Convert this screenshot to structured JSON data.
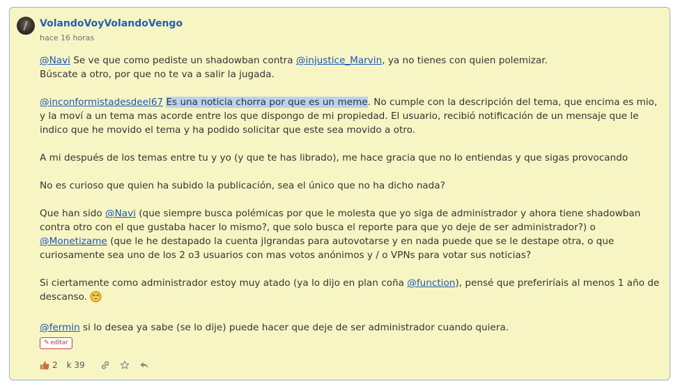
{
  "post": {
    "username": "VolandoVoyVolandoVengo",
    "timestamp": "hace 16 horas",
    "p1": {
      "m1": "@Navi",
      "t1": " Se ve que como pediste un shadowban contra ",
      "m2": "@injustice_Marvin",
      "t2": ", ya no tienes con quien polemizar.",
      "t3": "Búscate a otro, por que no te va a salir la jugada."
    },
    "p2": {
      "m1": "@inconformistadesdeel67",
      "highlight": "Es una noticia chorra por que es un meme",
      "t1": ". No cumple con la descripción del tema, que encima es mio, y la moví a un tema mas acorde entre los que dispongo de mi propiedad. El usuario, recibió notificación de un mensaje que le indico que he movido el tema y ha podido solicitar que este sea movido a otro."
    },
    "p3": "A mi después de los temas entre tu y yo (y que te has librado), me hace gracia que no lo entiendas y que sigas provocando",
    "p4": "No es curioso que quien ha subido la publicación, sea el único que no ha dicho nada?",
    "p5": {
      "t1": "Que han sido ",
      "m1": "@Navi",
      "t2": " (que siempre busca polémicas por que le molesta que yo siga de administrador y ahora tiene shadowban contra otro con el que gustaba hacer lo mismo?, que solo busca el reporte para que yo deje de ser administrador?) o ",
      "m2": "@Monetizame",
      "t3": " (que le he destapado la cuenta jlgrandas para autovotarse y en nada puede que se le destape otra, o que curiosamente sea uno de los 2 o3 usuarios con mas votos anónimos y / o VPNs para votar sus noticias?"
    },
    "p6": {
      "t1": "Si ciertamente como administrador estoy muy atado (ya lo dijo en plan coña ",
      "m1": "@function",
      "t2": "), pensé que preferiríais al menos 1 año de descanso. "
    },
    "p7": {
      "m1": "@fermin",
      "t1": " si lo desea ya sabe (se lo dije) puede hacer que deje de ser administrador cuando quiera."
    },
    "edit_label": "editar",
    "likes": "2",
    "karma": "k 39"
  },
  "colors": {
    "card_bg": "#f8f5c4",
    "card_border": "#9bb3d3",
    "link": "#1a56b8",
    "username": "#1f5fb5",
    "like": "#c4743c",
    "edit_border": "#d23b3b"
  },
  "icons": [
    "avatar",
    "pencil-icon",
    "thumbs-up-icon",
    "link-icon",
    "star-icon",
    "reply-icon",
    "laughing-emoji"
  ]
}
